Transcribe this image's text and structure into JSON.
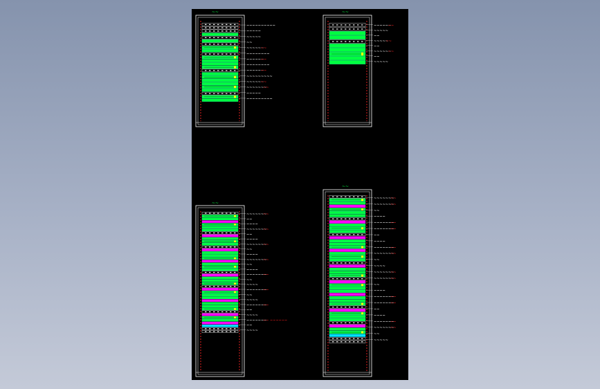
{
  "colors": {
    "background_gradient_top": "#8593ad",
    "background_gradient_bottom": "#c4cad8",
    "drawing_bg": "#000000",
    "frame": "#ffffff",
    "rail": "#e02020",
    "panel": "#00ff40",
    "panel_alt": "#20ff90",
    "patch": "#ff00ff",
    "accent_cyan": "#00e0ff",
    "accent_yellow": "#ffff00",
    "label_white": "#ffffff",
    "label_red": "#ff2020",
    "title": "#00ff40"
  },
  "racks": [
    {
      "id": "rack-top-left",
      "title": "~~",
      "units": [
        "white",
        "white",
        "white",
        "green",
        "white",
        "green",
        "white",
        "green",
        "green",
        "white",
        "green",
        "green",
        "green",
        "green",
        "white",
        "green",
        "green",
        "green",
        "green",
        "green",
        "green",
        "white",
        "green",
        "green"
      ],
      "labels": [
        {
          "text": "~~~~~~~~~~",
          "red": ""
        },
        {
          "text": "~~~~~",
          "red": ""
        },
        {
          "text": "~~~~~",
          "red": ""
        },
        {
          "text": "~~",
          "red": ""
        },
        {
          "text": "~~~~~~",
          "red": "~~"
        },
        {
          "text": "~~~~~~~~",
          "red": ""
        },
        {
          "text": "~~~~~~",
          "red": "~~"
        },
        {
          "text": "~~~~~~~~",
          "red": ""
        },
        {
          "text": "~~~~~~",
          "red": "~~"
        },
        {
          "text": "~~~~~~~~~",
          "red": ""
        },
        {
          "text": "~~~~~~",
          "red": "~~"
        },
        {
          "text": "~~~~~~~",
          "red": "~~"
        },
        {
          "text": "~~~~~",
          "red": ""
        },
        {
          "text": "~~~~~~~~~",
          "red": ""
        }
      ]
    },
    {
      "id": "rack-top-right",
      "title": "~~",
      "units": [
        "white",
        "white",
        "green",
        "green",
        "white",
        "green",
        "green",
        "green",
        "green",
        "green"
      ],
      "labels": [
        {
          "text": "~~~~~~",
          "red": "~~"
        },
        {
          "text": "~~~~~",
          "red": ""
        },
        {
          "text": "~~",
          "red": ""
        },
        {
          "text": "~~~~~",
          "red": "~~"
        },
        {
          "text": "~~",
          "red": ""
        },
        {
          "text": "~~~~~~",
          "red": "~~"
        },
        {
          "text": "~~",
          "red": ""
        },
        {
          "text": "~~~~~",
          "red": ""
        }
      ]
    },
    {
      "id": "rack-bottom-left",
      "title": "~~",
      "units": [
        "white",
        "green",
        "green",
        "patch",
        "green",
        "green",
        "green",
        "white",
        "patch",
        "green",
        "green",
        "green",
        "white",
        "patch",
        "green",
        "green",
        "green",
        "patch",
        "green",
        "green",
        "green",
        "white",
        "patch",
        "green",
        "green",
        "green",
        "white",
        "patch",
        "green",
        "green",
        "green",
        "patch",
        "green",
        "green",
        "green",
        "white",
        "patch",
        "green",
        "green",
        "patch",
        "cyan",
        "white",
        "white"
      ],
      "labels": [
        {
          "text": "~~~~~~~",
          "red": "~~"
        },
        {
          "text": "~~",
          "red": ""
        },
        {
          "text": "~~~~",
          "red": ""
        },
        {
          "text": "~~~~~~~",
          "red": "~~"
        },
        {
          "text": "~~",
          "red": ""
        },
        {
          "text": "~~~~",
          "red": ""
        },
        {
          "text": "~~~~~~~",
          "red": "~~"
        },
        {
          "text": "~~",
          "red": ""
        },
        {
          "text": "~~~~",
          "red": ""
        },
        {
          "text": "~~~~~~~",
          "red": "~~"
        },
        {
          "text": "~~",
          "red": ""
        },
        {
          "text": "~~~~",
          "red": ""
        },
        {
          "text": "~~~~~~~",
          "red": "~~"
        },
        {
          "text": "~~",
          "red": ""
        },
        {
          "text": "~~~~",
          "red": ""
        },
        {
          "text": "~~~~~~~",
          "red": "~~"
        },
        {
          "text": "~~",
          "red": ""
        },
        {
          "text": "~~~~",
          "red": ""
        },
        {
          "text": "~~~~~~~",
          "red": "~~"
        },
        {
          "text": "~~",
          "red": ""
        },
        {
          "text": "~~~~",
          "red": ""
        },
        {
          "text": "~~~~~~~",
          "red": "~~ ~~~~~~"
        },
        {
          "text": "~~",
          "red": ""
        },
        {
          "text": "~~~~",
          "red": ""
        }
      ]
    },
    {
      "id": "rack-bottom-right",
      "title": "~~",
      "units": [
        "white",
        "green",
        "green",
        "patch",
        "green",
        "green",
        "green",
        "white",
        "patch",
        "green",
        "green",
        "green",
        "white",
        "patch",
        "green",
        "green",
        "green",
        "patch",
        "green",
        "green",
        "green",
        "white",
        "patch",
        "green",
        "green",
        "green",
        "white",
        "patch",
        "green",
        "green",
        "green",
        "patch",
        "green",
        "green",
        "green",
        "white",
        "patch",
        "green",
        "green",
        "green",
        "white",
        "patch",
        "green",
        "green",
        "cyan",
        "white",
        "white"
      ],
      "labels": [
        {
          "text": "~~~~~~~",
          "red": "~~"
        },
        {
          "text": "~~~~~~~",
          "red": "~~"
        },
        {
          "text": "~~",
          "red": ""
        },
        {
          "text": "~~~~",
          "red": ""
        },
        {
          "text": "~~~~~~~",
          "red": "~~"
        },
        {
          "text": "~~~~~~~",
          "red": "~~"
        },
        {
          "text": "~~",
          "red": ""
        },
        {
          "text": "~~~~",
          "red": ""
        },
        {
          "text": "~~~~~~~",
          "red": "~~"
        },
        {
          "text": "~~~~~~~",
          "red": "~~"
        },
        {
          "text": "~~",
          "red": ""
        },
        {
          "text": "~~~~",
          "red": ""
        },
        {
          "text": "~~~~~~~",
          "red": "~~"
        },
        {
          "text": "~~~~~~~",
          "red": "~~"
        },
        {
          "text": "~~",
          "red": ""
        },
        {
          "text": "~~~~",
          "red": ""
        },
        {
          "text": "~~~~~~~",
          "red": "~~"
        },
        {
          "text": "~~~~~~~",
          "red": "~~"
        },
        {
          "text": "~~",
          "red": ""
        },
        {
          "text": "~~~~",
          "red": ""
        },
        {
          "text": "~~~~~~~",
          "red": "~~"
        },
        {
          "text": "~~~~~~~",
          "red": "~~"
        },
        {
          "text": "~~",
          "red": ""
        },
        {
          "text": "~~~~~",
          "red": ""
        }
      ]
    }
  ]
}
